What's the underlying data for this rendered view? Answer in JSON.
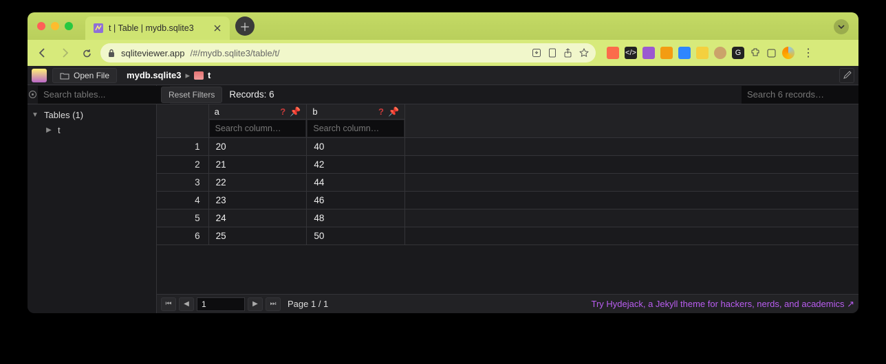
{
  "browser": {
    "tab_title": "t | Table | mydb.sqlite3",
    "url_host": "sqliteviewer.app",
    "url_path": "/#/mydb.sqlite3/table/t/"
  },
  "app": {
    "open_file_label": "Open File",
    "breadcrumb_db": "mydb.sqlite3",
    "breadcrumb_table": "t",
    "sidebar": {
      "search_placeholder": "Search tables...",
      "tables_header": "Tables (1)",
      "tables": [
        "t"
      ]
    },
    "filterbar": {
      "reset_label": "Reset Filters",
      "records_label": "Records: 6",
      "records_search_placeholder": "Search 6 records…"
    },
    "columns": [
      {
        "name": "a",
        "search_placeholder": "Search column…"
      },
      {
        "name": "b",
        "search_placeholder": "Search column…"
      }
    ],
    "rows": [
      {
        "n": "1",
        "a": "20",
        "b": "40"
      },
      {
        "n": "2",
        "a": "21",
        "b": "42"
      },
      {
        "n": "3",
        "a": "22",
        "b": "44"
      },
      {
        "n": "4",
        "a": "23",
        "b": "46"
      },
      {
        "n": "5",
        "a": "24",
        "b": "48"
      },
      {
        "n": "6",
        "a": "25",
        "b": "50"
      }
    ],
    "pager": {
      "page_input": "1",
      "page_label": "Page 1 / 1",
      "promo": "Try Hydejack, a Jekyll theme for hackers, nerds, and academics ↗"
    }
  }
}
